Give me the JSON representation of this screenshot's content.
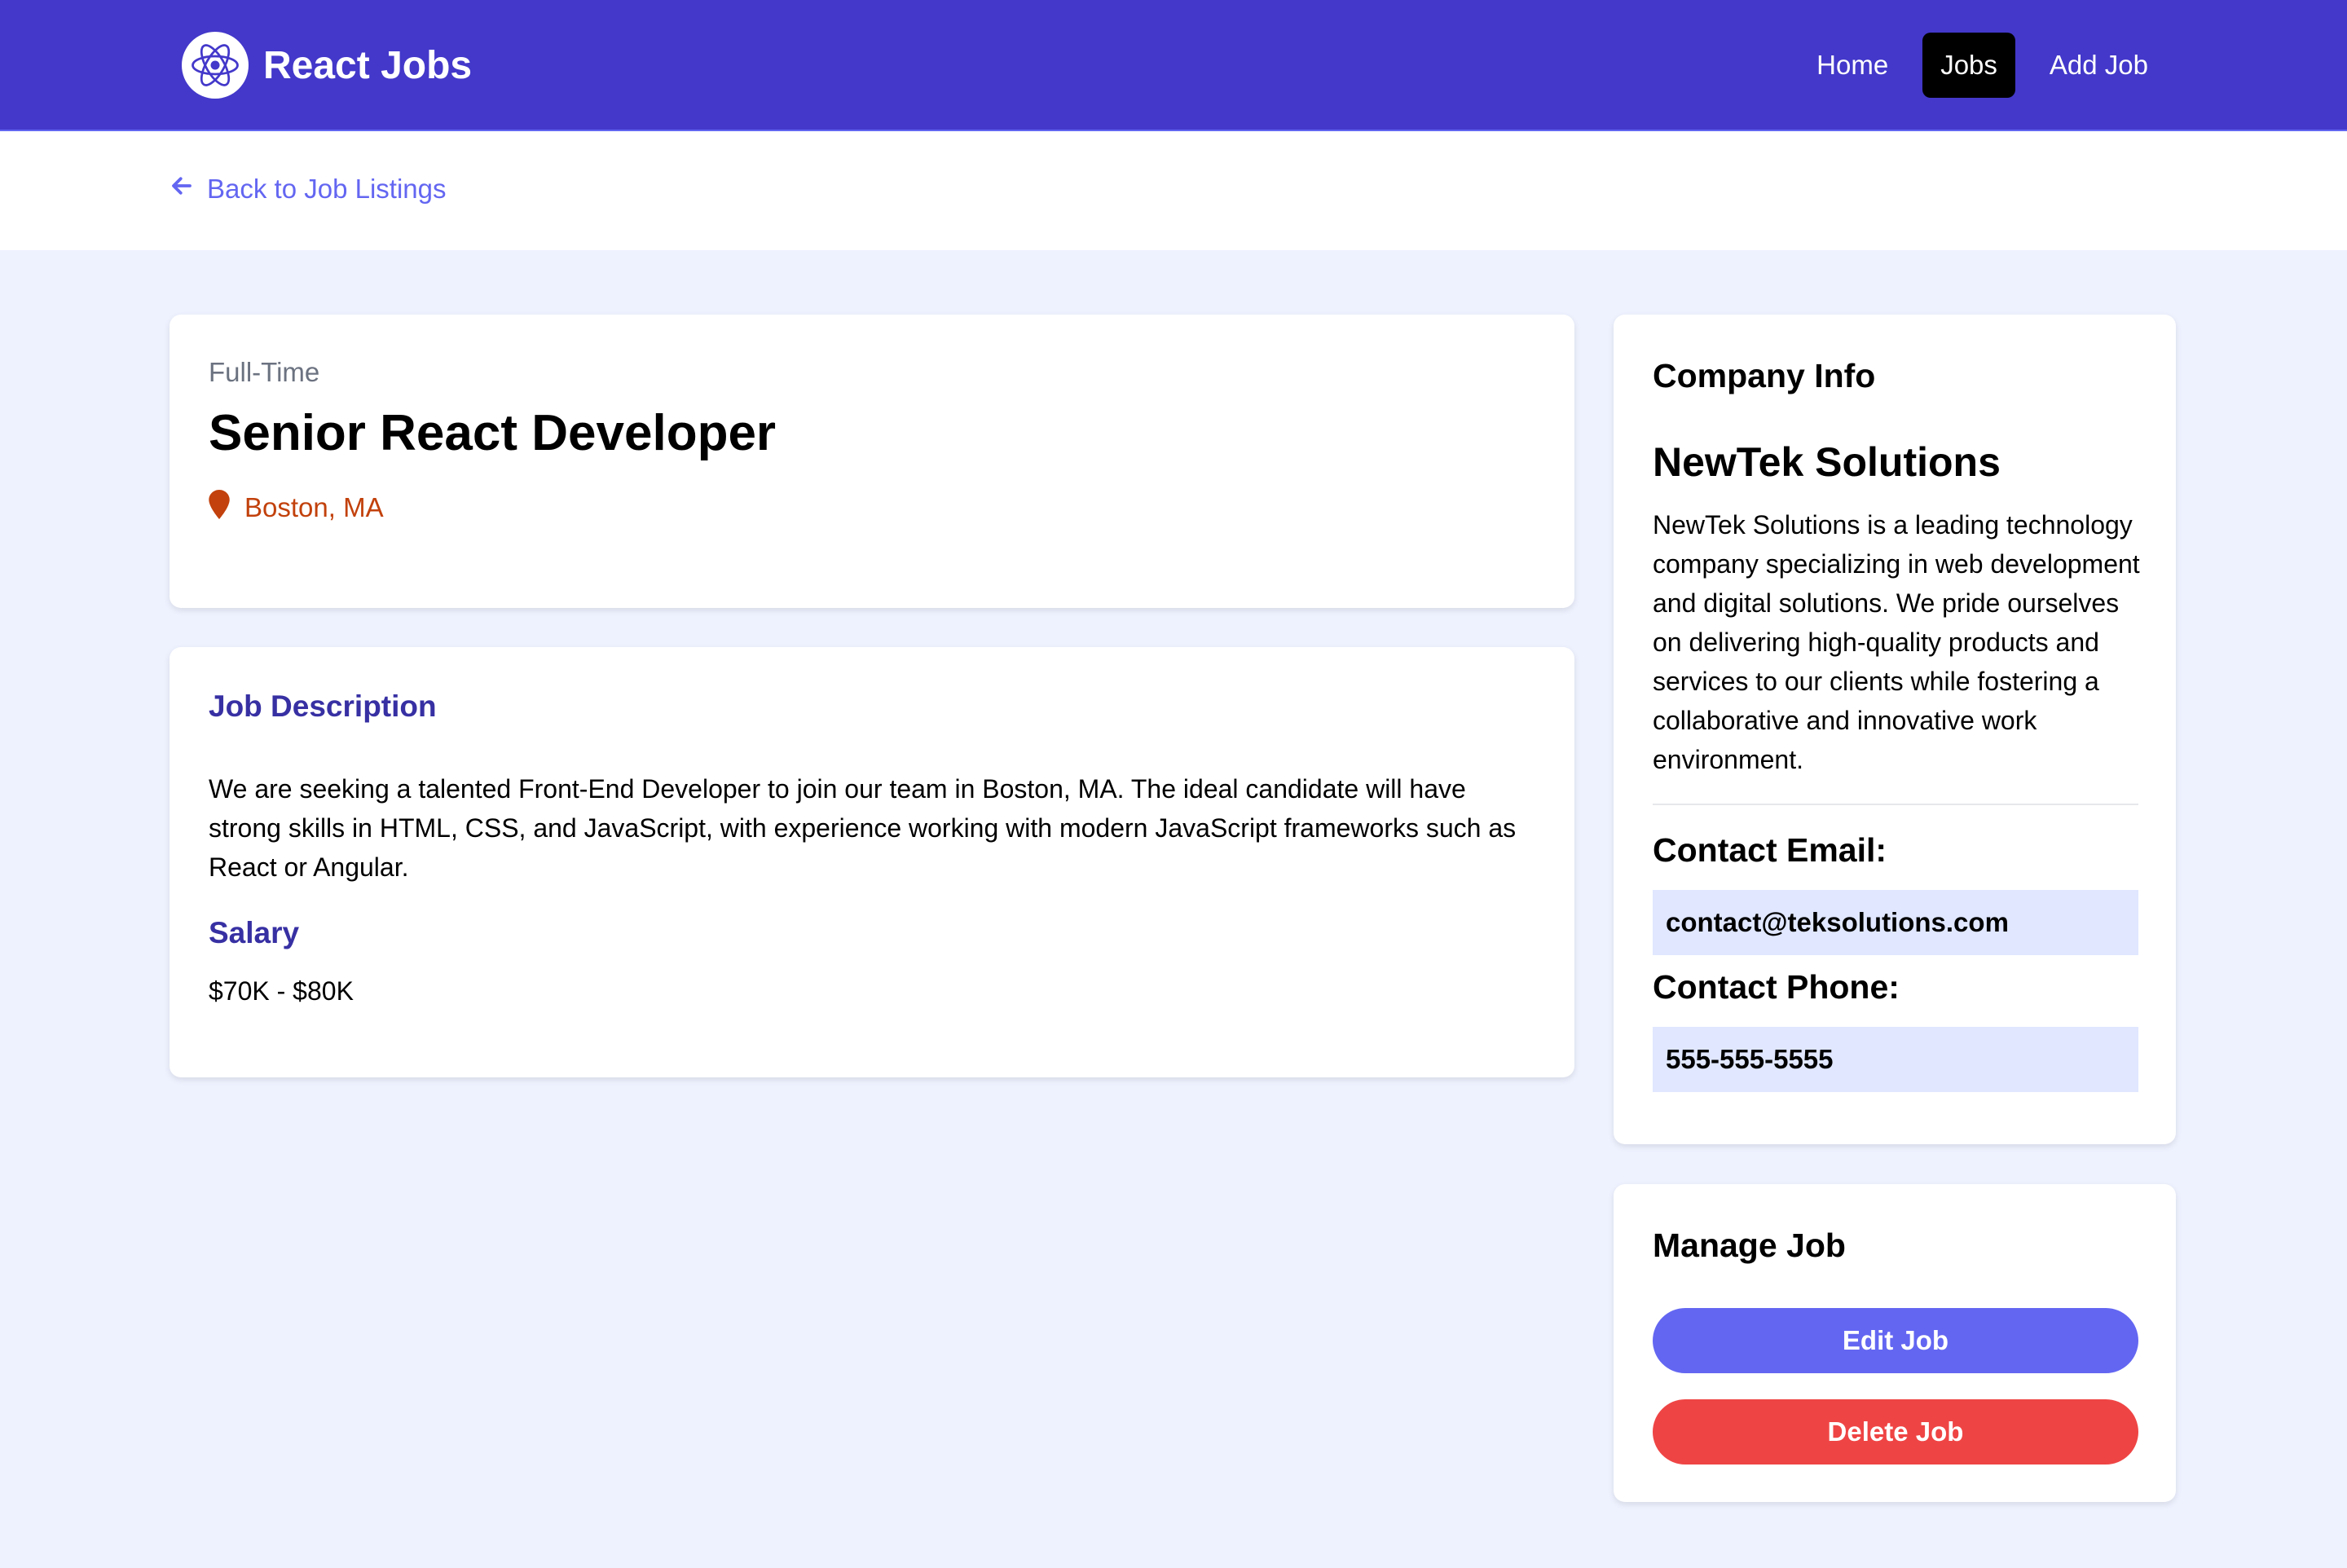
{
  "nav": {
    "brand": "React Jobs",
    "links": [
      "Home",
      "Jobs",
      "Add Job"
    ],
    "active": "Jobs",
    "colors": {
      "bar": "#4338ca",
      "active_bg": "#000000"
    }
  },
  "back_link": {
    "label": "Back to Job Listings",
    "icon": "arrow-left-icon"
  },
  "job": {
    "type": "Full-Time",
    "title": "Senior React Developer",
    "location": "Boston, MA",
    "description_heading": "Job Description",
    "description": "We are seeking a talented Front-End Developer to join our team in Boston, MA. The ideal candidate will have strong skills in HTML, CSS, and JavaScript, with experience working with modern JavaScript frameworks such as React or Angular.",
    "salary_heading": "Salary",
    "salary": "$70K - $80K"
  },
  "company": {
    "heading": "Company Info",
    "name": "NewTek Solutions",
    "description": "NewTek Solutions is a leading technology company specializing in web development and digital solutions. We pride ourselves on delivering high-quality products and services to our clients while fostering a collaborative and innovative work environment.",
    "email_label": "Contact Email:",
    "email": "contact@teksolutions.com",
    "phone_label": "Contact Phone:",
    "phone": "555-555-5555"
  },
  "manage": {
    "heading": "Manage Job",
    "edit_label": "Edit Job",
    "delete_label": "Delete Job",
    "colors": {
      "edit": "#6366f1",
      "delete": "#ef4444"
    }
  }
}
